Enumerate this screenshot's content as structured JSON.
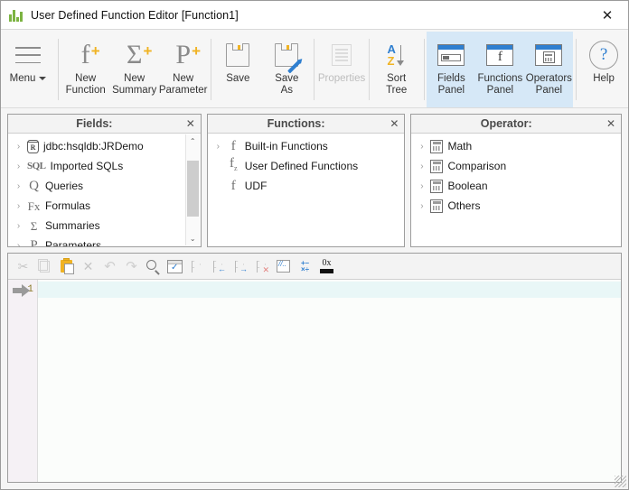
{
  "window": {
    "title": "User Defined Function Editor [Function1]",
    "logo_icon": "bar-chart-logo-icon",
    "close_label": "✕"
  },
  "ribbon": {
    "menu": {
      "label": "Menu",
      "icon": "hamburger-icon",
      "caret": "▾"
    },
    "items": [
      {
        "id": "new-function",
        "label_line1": "New",
        "label_line2": "Function",
        "icon": "f-plus-icon",
        "glyph": "f",
        "disabled": false,
        "active": false
      },
      {
        "id": "new-summary",
        "label_line1": "New",
        "label_line2": "Summary",
        "icon": "sigma-plus-icon",
        "glyph": "Σ",
        "disabled": false,
        "active": false
      },
      {
        "id": "new-parameter",
        "label_line1": "New",
        "label_line2": "Parameter",
        "icon": "p-plus-icon",
        "glyph": "P",
        "disabled": false,
        "active": false
      },
      {
        "id": "save",
        "label_line1": "Save",
        "label_line2": "",
        "icon": "floppy-disk-icon",
        "disabled": false,
        "active": false
      },
      {
        "id": "save-as",
        "label_line1": "Save As",
        "label_line2": "",
        "icon": "floppy-disk-pencil-icon",
        "disabled": false,
        "active": false
      },
      {
        "id": "properties",
        "label_line1": "Properties",
        "label_line2": "",
        "icon": "properties-list-icon",
        "disabled": true,
        "active": false
      },
      {
        "id": "sort-tree",
        "label_line1": "Sort",
        "label_line2": "Tree",
        "icon": "sort-az-icon",
        "disabled": false,
        "active": false
      },
      {
        "id": "fields-panel",
        "label_line1": "Fields",
        "label_line2": "Panel",
        "icon": "fields-panel-icon",
        "disabled": false,
        "active": true
      },
      {
        "id": "functions-panel",
        "label_line1": "Functions",
        "label_line2": "Panel",
        "icon": "functions-panel-icon",
        "disabled": false,
        "active": true
      },
      {
        "id": "operators-panel",
        "label_line1": "Operators",
        "label_line2": "Panel",
        "icon": "operators-panel-icon",
        "disabled": false,
        "active": true
      },
      {
        "id": "help",
        "label_line1": "Help",
        "label_line2": "",
        "icon": "question-circle-icon",
        "disabled": false,
        "active": false
      }
    ],
    "plus_badge": "+"
  },
  "panels": {
    "fields": {
      "title": "Fields:",
      "close": "✕",
      "scrollbar": {
        "up": "⌃",
        "down": "⌄"
      },
      "items": [
        {
          "label": "jdbc:hsqldb:JRDemo",
          "icon": "database-icon",
          "expander": "›"
        },
        {
          "label": "Imported SQLs",
          "icon": "sql-icon",
          "expander": "›"
        },
        {
          "label": "Queries",
          "icon": "query-q-icon",
          "expander": "›"
        },
        {
          "label": "Formulas",
          "icon": "fx-icon",
          "expander": "›"
        },
        {
          "label": "Summaries",
          "icon": "sigma-icon",
          "expander": "›"
        },
        {
          "label": "Parameters",
          "icon": "p-icon",
          "expander": "›"
        }
      ]
    },
    "functions": {
      "title": "Functions:",
      "close": "✕",
      "items": [
        {
          "label": "Built-in Functions",
          "icon": "f-icon",
          "expander": "›"
        },
        {
          "label": "User Defined Functions",
          "icon": "fz-icon",
          "expander": ""
        },
        {
          "label": "UDF",
          "icon": "f-icon",
          "expander": ""
        }
      ]
    },
    "operator": {
      "title": "Operator:",
      "close": "✕",
      "items": [
        {
          "label": "Math",
          "icon": "calculator-icon",
          "expander": "›"
        },
        {
          "label": "Comparison",
          "icon": "calculator-icon",
          "expander": "›"
        },
        {
          "label": "Boolean",
          "icon": "calculator-icon",
          "expander": "›"
        },
        {
          "label": "Others",
          "icon": "calculator-icon",
          "expander": "›"
        }
      ]
    }
  },
  "editor": {
    "toolbar": [
      {
        "id": "cut",
        "icon": "scissors-icon",
        "disabled": true
      },
      {
        "id": "copy",
        "icon": "copy-icon",
        "disabled": true
      },
      {
        "id": "paste",
        "icon": "paste-icon",
        "disabled": false
      },
      {
        "id": "delete",
        "icon": "close-x-icon",
        "disabled": true
      },
      {
        "id": "undo",
        "icon": "undo-arrow-icon",
        "disabled": true
      },
      {
        "id": "redo",
        "icon": "redo-arrow-icon",
        "disabled": true
      },
      {
        "id": "find",
        "icon": "search-icon",
        "disabled": false
      },
      {
        "id": "check-syntax",
        "icon": "checkbox-check-icon",
        "disabled": false
      },
      {
        "id": "run",
        "icon": "flag-icon",
        "disabled": true
      },
      {
        "id": "step-back",
        "icon": "flag-back-icon",
        "disabled": true
      },
      {
        "id": "step-forward",
        "icon": "flag-forward-icon",
        "disabled": true
      },
      {
        "id": "stop",
        "icon": "flag-stop-icon",
        "disabled": true
      },
      {
        "id": "comment",
        "icon": "comment-slashes-icon",
        "disabled": false
      },
      {
        "id": "math-ops",
        "icon": "math-operators-icon",
        "disabled": false
      },
      {
        "id": "variables",
        "icon": "ox-variable-icon",
        "disabled": false
      }
    ],
    "gutter_lines": [
      "1"
    ],
    "code_lines": [
      ""
    ],
    "cursor_icon": "execution-pointer-arrow-icon"
  },
  "colors": {
    "accent_blue": "#2f7fd0",
    "accent_yellow": "#f0b323",
    "active_tab_bg": "#d6e8f7",
    "current_line_bg": "#e9f7f7",
    "logo_green": "#7cb342"
  }
}
